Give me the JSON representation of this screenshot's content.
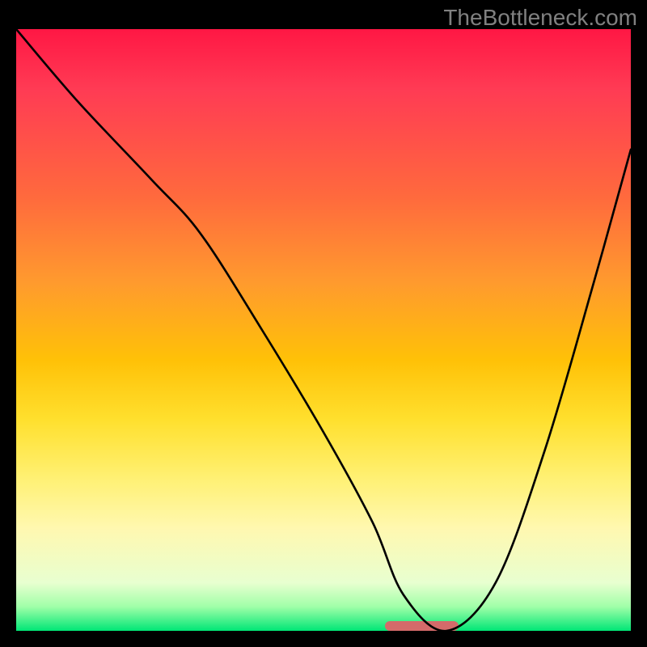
{
  "watermark": "TheBottleneck.com",
  "chart_data": {
    "type": "line",
    "title": "",
    "xlabel": "",
    "ylabel": "",
    "xlim": [
      0,
      100
    ],
    "ylim": [
      0,
      100
    ],
    "grid": false,
    "legend": "none",
    "marker": {
      "x_start_pct": 60,
      "x_end_pct": 72,
      "color": "#d46a6a"
    },
    "series": [
      {
        "name": "bottleneck-curve",
        "x": [
          0,
          10,
          22,
          30,
          40,
          50,
          58,
          63,
          70,
          78,
          86,
          94,
          100
        ],
        "values": [
          100,
          88,
          75,
          66,
          50,
          33,
          18,
          6,
          0,
          8,
          30,
          58,
          80
        ]
      }
    ],
    "background_gradient": [
      {
        "stop": 0,
        "color": "#ff1744"
      },
      {
        "stop": 28,
        "color": "#ff6a3d"
      },
      {
        "stop": 55,
        "color": "#ffc107"
      },
      {
        "stop": 83,
        "color": "#fff8b0"
      },
      {
        "stop": 100,
        "color": "#00e676"
      }
    ]
  }
}
